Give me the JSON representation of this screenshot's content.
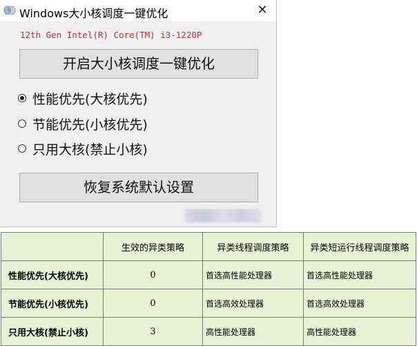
{
  "window": {
    "title": "Windows大小核调度一键优化",
    "close_glyph": "✕",
    "cpu_label": "12th Gen Intel(R) Core(TM) i3-1220P",
    "optimize_button": "开启大小核调度一键优化",
    "options": [
      {
        "label": "性能优先(大核优先)",
        "checked": true
      },
      {
        "label": "节能优先(小核优先)",
        "checked": false
      },
      {
        "label": "只用大核(禁止小核)",
        "checked": false
      }
    ],
    "restore_button": "恢复系统默认设置",
    "icons": {
      "app": "app-icon",
      "close": "close-icon"
    }
  },
  "table": {
    "headers": [
      "",
      "生效的异类策略",
      "异类线程调度策略",
      "异类短运行线程调度策略"
    ],
    "rows": [
      {
        "mode": "性能优先(大核优先)",
        "policy": "0",
        "thread": "首选高性能处理器",
        "short_thread": "首选高性能处理器"
      },
      {
        "mode": "节能优先(小核优先)",
        "policy": "0",
        "thread": "首选高效处理器",
        "short_thread": "首选高效处理器"
      },
      {
        "mode": "只用大核(禁止小核)",
        "policy": "3",
        "thread": "高性能处理器",
        "short_thread": "高性能处理器"
      }
    ]
  },
  "colors": {
    "cpu_label": "#c0302b",
    "table_bg": "#e8f3d6",
    "button_bg": "#e1e1e1",
    "window_client": "#f0f0f0"
  }
}
